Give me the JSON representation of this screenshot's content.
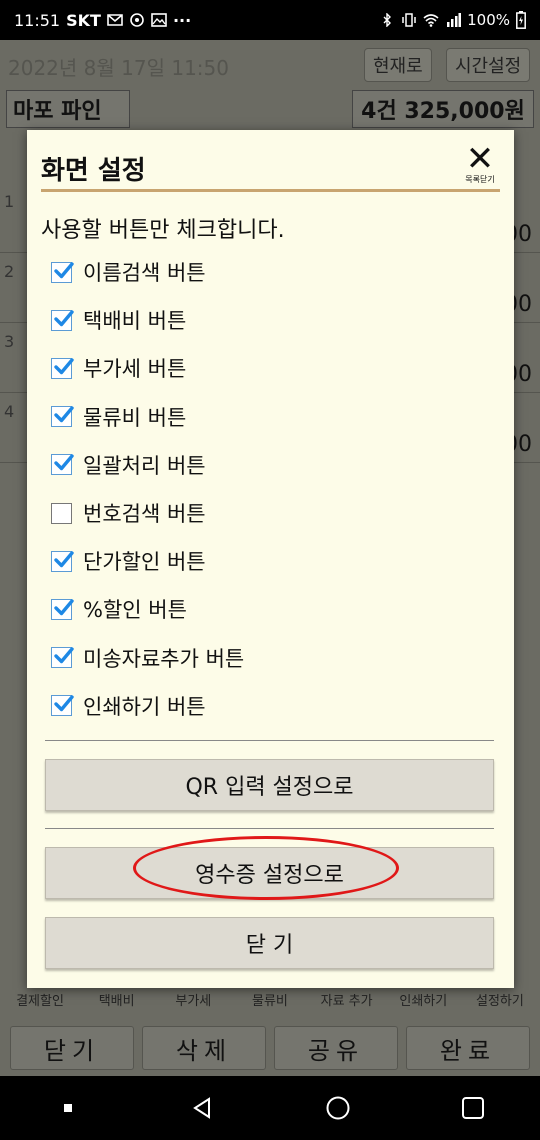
{
  "status_bar": {
    "time": "11:51",
    "carrier": "SKT",
    "battery": "100%"
  },
  "background_app": {
    "date": "2022년 8월 17일 11:50",
    "now_button": "현재로",
    "time_setting_button": "시간설정",
    "shop_name": "마포 파인",
    "total": "4건 325,000원",
    "rows": [
      {
        "num": "1",
        "value": "00"
      },
      {
        "num": "2",
        "value": "00"
      },
      {
        "num": "3",
        "value": "00"
      },
      {
        "num": "4",
        "value": "00"
      }
    ],
    "toolbar": [
      "결제할인",
      "택배비",
      "부가세",
      "물류비",
      "자료 추가",
      "인쇄하기",
      "설정하기"
    ],
    "bottom_buttons": [
      "닫기",
      "삭제",
      "공유",
      "완료"
    ]
  },
  "dialog": {
    "title": "화면 설정",
    "close_label": "목록닫기",
    "instruction": "사용할 버튼만 체크합니다.",
    "checkboxes": [
      {
        "label": "이름검색 버튼",
        "checked": true
      },
      {
        "label": "택배비 버튼",
        "checked": true
      },
      {
        "label": "부가세 버튼",
        "checked": true
      },
      {
        "label": "물류비 버튼",
        "checked": true
      },
      {
        "label": "일괄처리 버튼",
        "checked": true
      },
      {
        "label": "번호검색 버튼",
        "checked": false
      },
      {
        "label": "단가할인 버튼",
        "checked": true
      },
      {
        "label": "%할인 버튼",
        "checked": true
      },
      {
        "label": "미송자료추가 버튼",
        "checked": true
      },
      {
        "label": "인쇄하기 버튼",
        "checked": true
      }
    ],
    "qr_button": "QR 입력 설정으로",
    "receipt_button": "영수증 설정으로",
    "close_button": "닫 기"
  },
  "colors": {
    "dialog_bg": "#fdfce8",
    "header_underline": "#c8a470",
    "checkbox_check": "#1e88e5",
    "highlight": "#e01818"
  }
}
